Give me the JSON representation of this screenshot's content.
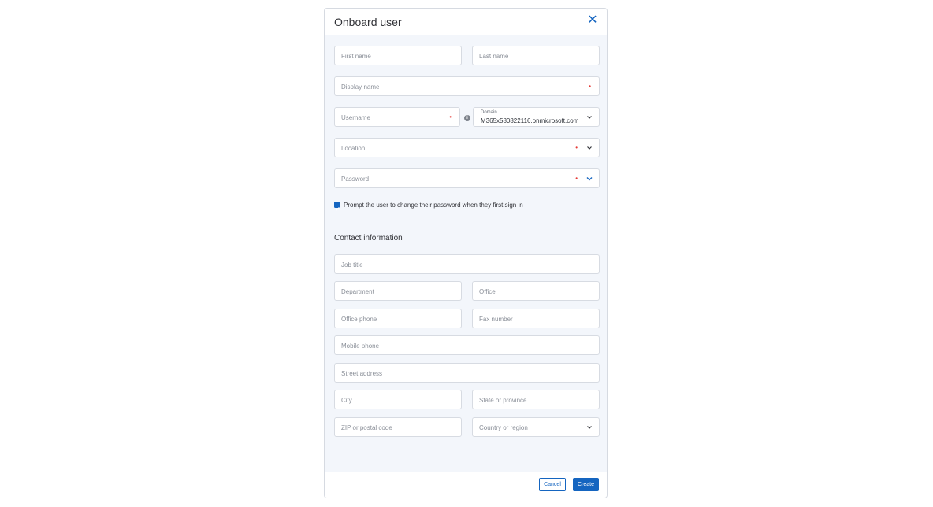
{
  "dialog": {
    "title": "Onboard user",
    "close_icon": "close-icon"
  },
  "form": {
    "first_name": "First name",
    "last_name": "Last name",
    "display_name": "Display name",
    "username": "Username",
    "required_marker": "•",
    "domain_label": "Domain",
    "domain_value": "M365x580822116.onmicrosoft.com",
    "location": "Location",
    "password": "Password",
    "prompt_password_change": "Prompt the user to change their password when they first sign in",
    "prompt_password_change_checked": true
  },
  "contact": {
    "title": "Contact information",
    "job_title": "Job title",
    "department": "Department",
    "office": "Office",
    "office_phone": "Office phone",
    "fax_number": "Fax number",
    "mobile_phone": "Mobile phone",
    "street_address": "Street address",
    "city": "City",
    "state_or_province": "State or province",
    "zip_code": "ZIP or postal code",
    "country_or_region": "Country or region"
  },
  "footer": {
    "cancel_label": "Cancel",
    "create_label": "Create"
  },
  "colors": {
    "accent": "#1565c0",
    "required": "#e53935",
    "panel_background": "#f3f6fb"
  }
}
